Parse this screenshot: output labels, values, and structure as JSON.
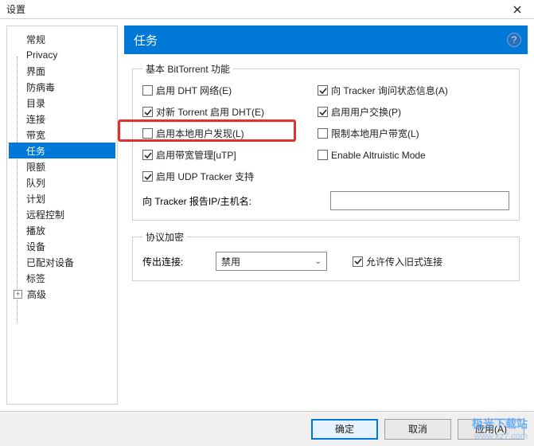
{
  "window": {
    "title": "设置"
  },
  "sidebar": {
    "items": [
      {
        "label": "常规"
      },
      {
        "label": "Privacy"
      },
      {
        "label": "界面"
      },
      {
        "label": "防病毒"
      },
      {
        "label": "目录"
      },
      {
        "label": "连接"
      },
      {
        "label": "带宽"
      },
      {
        "label": "任务",
        "selected": true
      },
      {
        "label": "限额"
      },
      {
        "label": "队列"
      },
      {
        "label": "计划"
      },
      {
        "label": "远程控制"
      },
      {
        "label": "播放"
      },
      {
        "label": "设备"
      },
      {
        "label": "已配对设备"
      },
      {
        "label": "标签"
      },
      {
        "label": "高级",
        "expander": true
      }
    ]
  },
  "header": {
    "title": "任务",
    "help": "?"
  },
  "group1": {
    "legend": "基本 BitTorrent 功能",
    "dht": {
      "label": "启用 DHT 网络(E)",
      "checked": false
    },
    "tracker_status": {
      "label": "向 Tracker 询问状态信息(A)",
      "checked": true
    },
    "new_dht": {
      "label": "对新 Torrent 启用 DHT(E)",
      "checked": true
    },
    "pex": {
      "label": "启用用户交换(P)",
      "checked": true
    },
    "lpd": {
      "label": "启用本地用户发现(L)",
      "checked": false
    },
    "limit_local": {
      "label": "限制本地用户带宽(L)",
      "checked": false
    },
    "utp": {
      "label": "启用带宽管理[uTP]",
      "checked": true
    },
    "altruistic": {
      "label": "Enable Altruistic Mode",
      "checked": false
    },
    "udp_tracker": {
      "label": "启用 UDP Tracker 支持",
      "checked": true
    },
    "report_ip_label": "向 Tracker 报告IP/主机名:",
    "report_ip_value": ""
  },
  "group2": {
    "legend": "协议加密",
    "out_label": "传出连接:",
    "out_value": "禁用",
    "allow_legacy": {
      "label": "允许传入旧式连接",
      "checked": true
    }
  },
  "buttons": {
    "ok": "确定",
    "cancel": "取消",
    "apply": "应用(A)"
  },
  "watermark": {
    "line1": "极光下载站",
    "line2": "www.xz7.com"
  }
}
